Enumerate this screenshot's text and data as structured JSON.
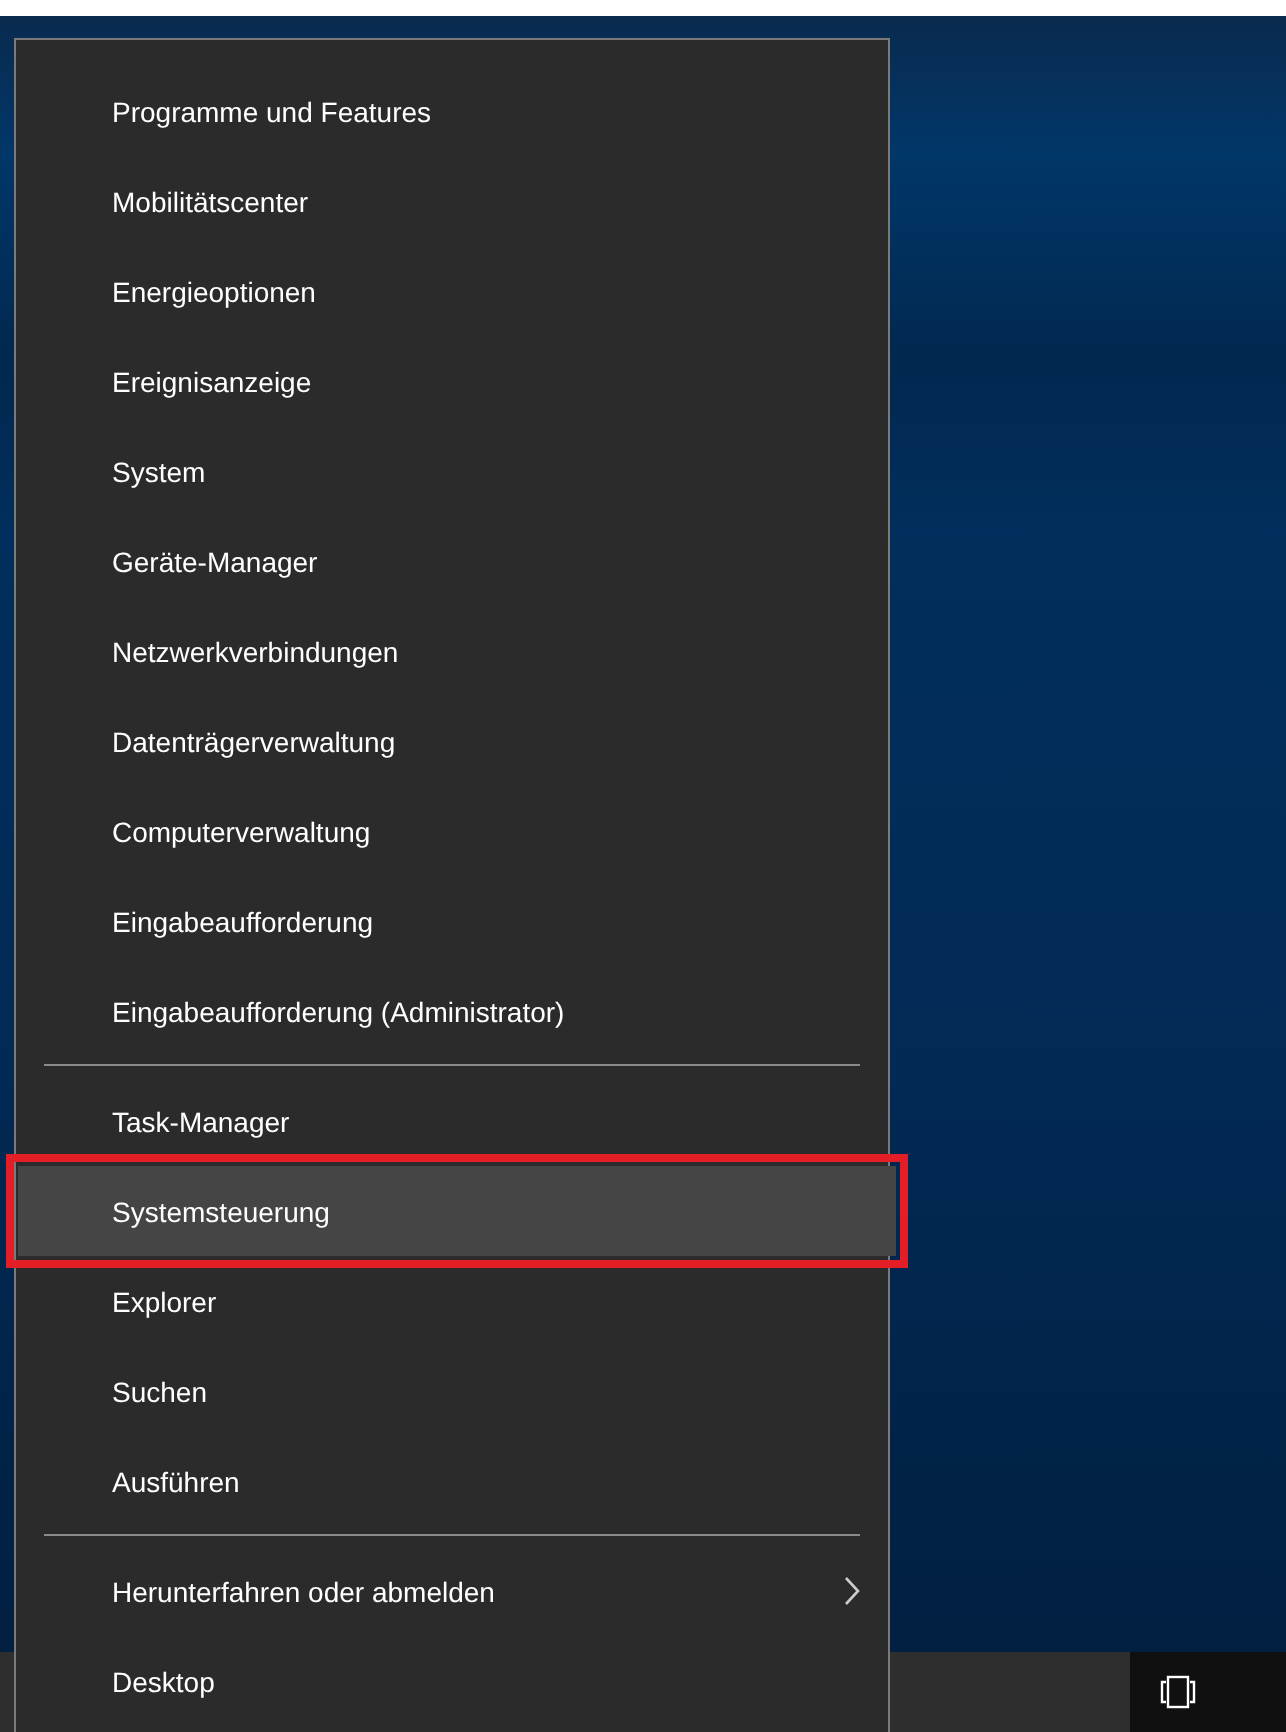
{
  "context_menu": {
    "groups": [
      [
        {
          "label": "Programme und Features",
          "selected": false,
          "kind": "plain"
        },
        {
          "label": "Mobilitätscenter",
          "selected": false,
          "kind": "plain"
        },
        {
          "label": "Energieoptionen",
          "selected": false,
          "kind": "plain"
        },
        {
          "label": "Ereignisanzeige",
          "selected": false,
          "kind": "plain"
        },
        {
          "label": "System",
          "selected": false,
          "kind": "plain"
        },
        {
          "label": "Geräte-Manager",
          "selected": false,
          "kind": "plain"
        },
        {
          "label": "Netzwerkverbindungen",
          "selected": false,
          "kind": "plain"
        },
        {
          "label": "Datenträgerverwaltung",
          "selected": false,
          "kind": "plain"
        },
        {
          "label": "Computerverwaltung",
          "selected": false,
          "kind": "plain"
        },
        {
          "label": "Eingabeaufforderung",
          "selected": false,
          "kind": "plain"
        },
        {
          "label": "Eingabeaufforderung (Administrator)",
          "selected": false,
          "kind": "plain"
        }
      ],
      [
        {
          "label": "Task-Manager",
          "selected": false,
          "kind": "plain"
        },
        {
          "label": "Systemsteuerung",
          "selected": true,
          "kind": "plain"
        },
        {
          "label": "Explorer",
          "selected": false,
          "kind": "plain"
        },
        {
          "label": "Suchen",
          "selected": false,
          "kind": "plain"
        },
        {
          "label": "Ausführen",
          "selected": false,
          "kind": "plain"
        }
      ],
      [
        {
          "label": "Herunterfahren oder abmelden",
          "selected": false,
          "kind": "submenu"
        },
        {
          "label": "Desktop",
          "selected": false,
          "kind": "plain"
        }
      ]
    ]
  }
}
